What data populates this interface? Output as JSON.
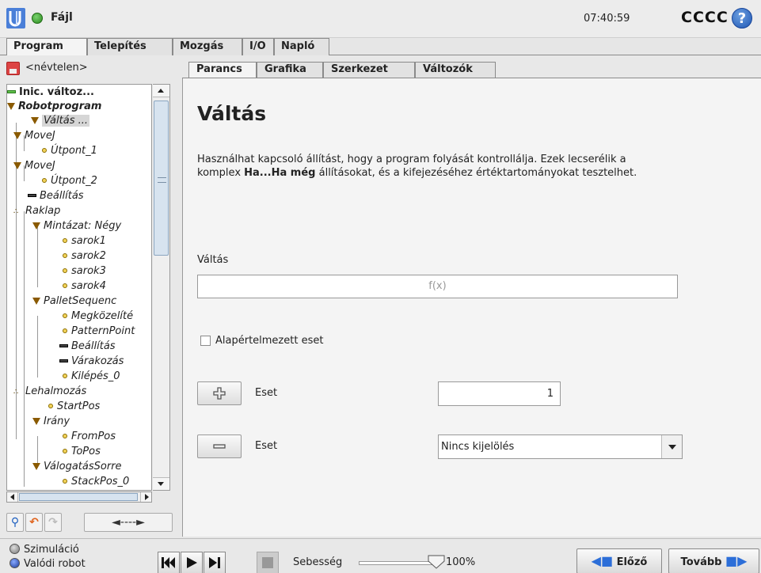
{
  "titlebar": {
    "file_menu": "Fájl",
    "time": "07:40:59",
    "robot_name": "CCCC",
    "help_icon": "?"
  },
  "main_tabs": [
    {
      "label": "Program",
      "active": true
    },
    {
      "label": "Telepítés",
      "active": false
    },
    {
      "label": "Mozgás",
      "active": false
    },
    {
      "label": "I/O",
      "active": false
    },
    {
      "label": "Napló",
      "active": false
    }
  ],
  "left": {
    "filename": "<névtelen>",
    "tree": [
      {
        "label": "Inic. változ...",
        "style": "bold",
        "icon": "bar-green"
      },
      {
        "label": "Robotprogram",
        "style": "bolditalic",
        "icon": "triangle"
      },
      {
        "label": "Váltás ...",
        "style": "italic",
        "icon": "triangle",
        "selected": true
      },
      {
        "label": "MoveJ",
        "style": "italic",
        "icon": "triangle"
      },
      {
        "label": "Útpont_1",
        "style": "italic",
        "icon": "dot"
      },
      {
        "label": "MoveJ",
        "style": "italic",
        "icon": "triangle"
      },
      {
        "label": "Útpont_2",
        "style": "italic",
        "icon": "dot"
      },
      {
        "label": "Beállítás",
        "style": "italic",
        "icon": "bar"
      },
      {
        "label": "Raklap",
        "style": "italic",
        "icon": "pallet"
      },
      {
        "label": "Mintázat: Négy",
        "style": "italic",
        "icon": "triangle"
      },
      {
        "label": "sarok1",
        "style": "italic",
        "icon": "dot"
      },
      {
        "label": "sarok2",
        "style": "italic",
        "icon": "dot"
      },
      {
        "label": "sarok3",
        "style": "italic",
        "icon": "dot"
      },
      {
        "label": "sarok4",
        "style": "italic",
        "icon": "dot"
      },
      {
        "label": "PalletSequenc",
        "style": "italic",
        "icon": "triangle"
      },
      {
        "label": "Megközelíté",
        "style": "italic",
        "icon": "dot"
      },
      {
        "label": "PatternPoint",
        "style": "italic",
        "icon": "dot"
      },
      {
        "label": "Beállítás",
        "style": "italic",
        "icon": "bar"
      },
      {
        "label": "Várakozás",
        "style": "italic",
        "icon": "bar"
      },
      {
        "label": "Kilépés_0",
        "style": "italic",
        "icon": "dot"
      },
      {
        "label": "Lehalmozás",
        "style": "italic",
        "icon": "pallet"
      },
      {
        "label": "StartPos",
        "style": "italic",
        "icon": "dot"
      },
      {
        "label": "Irány",
        "style": "italic",
        "icon": "triangle"
      },
      {
        "label": "FromPos",
        "style": "italic",
        "icon": "dot"
      },
      {
        "label": "ToPos",
        "style": "italic",
        "icon": "dot"
      },
      {
        "label": "VálogatásSorre",
        "style": "italic",
        "icon": "triangle"
      },
      {
        "label": "StackPos_0",
        "style": "italic",
        "icon": "dot"
      }
    ],
    "move_btn_label": "◄----►"
  },
  "subtabs": [
    {
      "label": "Parancs",
      "active": true
    },
    {
      "label": "Grafika",
      "active": false
    },
    {
      "label": "Szerkezet",
      "active": false
    },
    {
      "label": "Változók",
      "active": false
    }
  ],
  "content": {
    "title": "Váltás",
    "desc_part1": "Használhat kapcsoló állítást, hogy a program folyását kontrollálja. Ezek lecserélik a komplex ",
    "desc_bold": "Ha...Ha még",
    "desc_part2": " állításokat, és a kifejezéséhez értéktartományokat tesztelhet.",
    "switch_label": "Váltás",
    "fx_placeholder": "f(x)",
    "default_case_label": "Alapértelmezett eset",
    "default_case_checked": false,
    "add_case_label": "Eset",
    "add_case_value": "1",
    "remove_case_label": "Eset",
    "remove_case_selected": "Nincs kijelölés"
  },
  "footer": {
    "sim_label": "Szimuláció",
    "real_label": "Valódi robot",
    "speed_label": "Sebesség",
    "speed_value": "100%",
    "speed_fraction": 1.0,
    "prev_label": "Előző",
    "next_label": "Tovább"
  },
  "colors": {
    "accent_blue": "#2c6ed8",
    "running_green": "#2c8a1f"
  }
}
